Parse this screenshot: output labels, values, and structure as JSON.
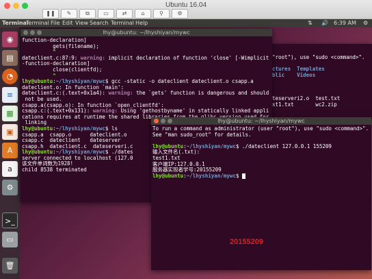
{
  "mac": {
    "title": "Ubuntu 16.04"
  },
  "ubuntu_bar": {
    "app": "Terminal",
    "menu": [
      "Terminal",
      "File",
      "Edit",
      "View",
      "Search",
      "Terminal",
      "Help"
    ],
    "clock": "6:39 AM"
  },
  "term_back": {
    "title": "lhy@ubuntu: ~/lhyshiyan/mywc",
    "lines": [
      "function-declaration]",
      "          gets(filename);",
      "          ^",
      "dateclient.c:87:9: warning: implicit declaration of function 'close' [-Wimplicit",
      "-function-declaration]",
      "          close(clientfd);",
      "          ^",
      "lhy@ubuntu:~/lhyshiyan/mywc$ gcc -static -o dateclient dateclient.o csapp.a",
      "dateclient.o: In function `main':",
      "dateclient.c:(.text+0x1a4): warning: the `gets' function is dangerous and should",
      " not be used.",
      "csapp.a(csapp.o): In function `open_clientfd':",
      "csapp.c:(.text+0x131): warning: Using 'gethostbyname' in statically linked appli",
      "cations requires at runtime the shared libraries from the glibc version used for",
      " linking",
      "lhy@ubuntu:~/lhyshiyan/mywc$ ls",
      "csapp.a  csapp.o      dateclient.o",
      "csapp.c  dateclient   dateserver",
      "csapp.h  dateclient.c  dateserveri.c",
      "lhy@ubuntu:~/lhyshiyan/mywc$ ./dates",
      "server connected to localhost (127.0",
      "该文件单词数为1928!",
      "child 8538 terminated"
    ]
  },
  "term_mid": {
    "lines": [
      "\"root\"), use \"sudo <command>\".",
      "",
      "ctures  Templates",
      "blic    Videos",
      "",
      "",
      "",
      "teserveri2.o  test.txt",
      "st1.txt       wc2.zip"
    ]
  },
  "term_front": {
    "title": "lhy@ubuntu: ~/lhyshiyan/mywc",
    "lines": [
      "To run a command as administrator (user \"root\"), use \"sudo <command>\".",
      "See \"man sudo_root\" for details.",
      "",
      "lhy@ubuntu:~/lhyshiyan/mywc$ ./dateclient 127.0.0.1 155209",
      "输入文件名(.txt):",
      "test1.txt",
      "客户端IP:127.0.0.1",
      "服务器实现者学号:20155209",
      "lhy@ubuntu:~/lhyshiyan/mywc$ "
    ],
    "watermark": "20155209"
  }
}
